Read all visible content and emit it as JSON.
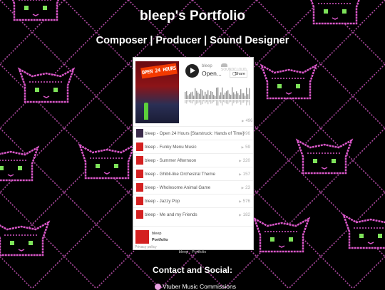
{
  "header": {
    "title": "bleep's Portfolio",
    "subtitle": "Composer | Producer | Sound Designer"
  },
  "player": {
    "artwork_sign_text": "OPEN 24 HOURS",
    "artist": "bleep",
    "track_title": "Open...",
    "soundcloud_label": "SOUNDCLOUD",
    "share_label": "Share",
    "current_plays": "496",
    "tracks": [
      {
        "name": "bleep - Open 24 Hours [Starstruck: Hands of Time]",
        "plays": "496"
      },
      {
        "name": "bleep - Funky Menu Music",
        "plays": "59"
      },
      {
        "name": "bleep - Summer Afternoon",
        "plays": "320"
      },
      {
        "name": "bleep - Ghibli-like Orchestral Theme",
        "plays": "157"
      },
      {
        "name": "bleep - Wholesome Animal Game",
        "plays": "23"
      },
      {
        "name": "bleep - Jazzy Pop",
        "plays": "576"
      },
      {
        "name": "bleep - Me and my Friends",
        "plays": "182"
      }
    ],
    "footer": {
      "artist": "bleep",
      "playlist": "Portfolio",
      "privacy": "Privacy policy"
    }
  },
  "caption": "bleep · Portfolio",
  "contact": {
    "heading": "Contact and Social:",
    "commission_label": "Vtuber Music Commissions"
  },
  "colors": {
    "background": "#000000",
    "pattern_pink": "#d957c8",
    "pattern_green": "#7ee35a",
    "accent_red": "#d42020"
  }
}
